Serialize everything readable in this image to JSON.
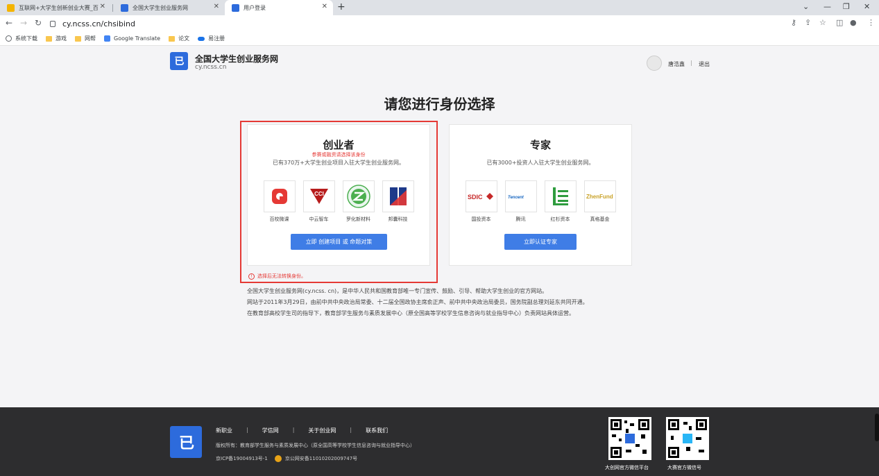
{
  "browser": {
    "tabs": [
      {
        "title": "互联网+大学生创新创业大赛_百",
        "favicon_color": "#f4b400"
      },
      {
        "title": "全国大学生创业服务网",
        "favicon_color": "#2d6bdc"
      },
      {
        "title": "用户登录",
        "favicon_color": "#2d6bdc"
      }
    ],
    "url": "cy.ncss.cn/chsibind",
    "bookmarks": [
      "系统下载",
      "游戏",
      "网帮",
      "Google Translate",
      "论文",
      "易注册"
    ]
  },
  "header": {
    "logo_text": "已",
    "site_name": "全国大学生创业服务网",
    "site_domain": "cy.ncss.cn",
    "user_name": "唐浩鑫",
    "separator": "|",
    "logout": "退出"
  },
  "main": {
    "title": "请您进行身份选择",
    "founder": {
      "title": "创业者",
      "hint": "参赛或融资请选择该身份",
      "desc": "已有370万+大学生创业项目入驻大学生创业服务网。",
      "logos": [
        "百校微课",
        "中云智车",
        "罗化新材料",
        "邦囊科技"
      ],
      "cta": "立即 创建项目 或 命题对策"
    },
    "expert": {
      "title": "专家",
      "desc": "已有3000+投资人入驻大学生创业服务网。",
      "logos": [
        "国投资本",
        "腾讯",
        "红杉资本",
        "真格基金"
      ],
      "cta": "立即认证专家"
    },
    "warning": "选择后无法转换身份。",
    "intro": [
      "全国大学生创业服务网(cy.ncss. cn)，是中华人民共和国教育部唯一专门宣传、鼓励、引导、帮助大学生创业的官方网站。",
      "网站于2011年3月29日，由前中共中央政治局常委、十二届全国政协主席俞正声、前中共中央政治局委员，国务院副总理刘延东共同开通。",
      "在教育部高校学生司的指导下，教育部学生服务与素质发展中心（原全国高等学校学生信息咨询与就业指导中心）负责网站具体运营。"
    ]
  },
  "footer": {
    "links": [
      "新职业",
      "学信网",
      "关于创业网",
      "联系我们"
    ],
    "separator": "|",
    "copyright": "版权所有：教育部学生服务与素质发展中心（原全国高等学校学生信息咨询与就业指导中心）",
    "icp": "京ICP备19004913号-1",
    "police": "京公网安备11010202009747号",
    "qr_captions": [
      "大创网官方微信平台",
      "大赛官方微信号"
    ]
  },
  "colors": {
    "accent": "#3f7de6",
    "warning": "#e53935",
    "footer_bg": "#2d2d2f",
    "logo_blue": "#2d6bdc"
  }
}
